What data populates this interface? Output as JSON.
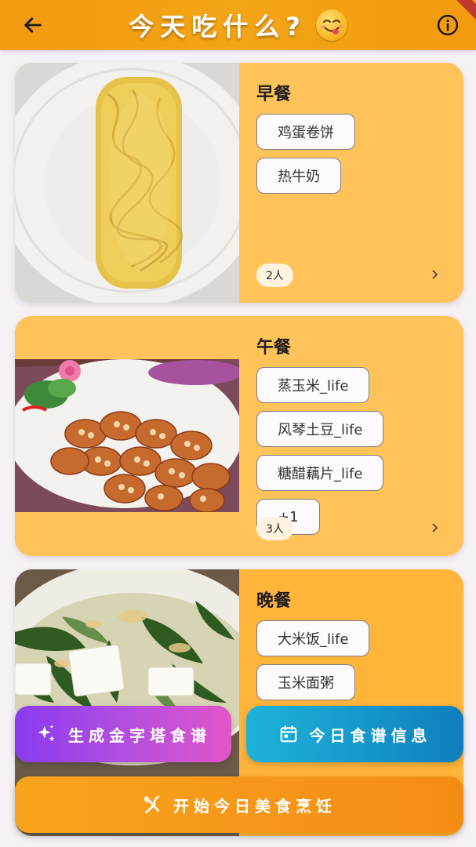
{
  "appbar": {
    "title": "今天吃什么?",
    "emoji_icon": "smiling-face-tongue-icon",
    "back_icon": "arrow-left-icon",
    "info_icon": "info-circle-icon",
    "accent_color": "#f39a0f"
  },
  "meals": [
    {
      "title": "早餐",
      "dishes": [
        "鸡蛋卷饼",
        "热牛奶"
      ],
      "people": "2人",
      "photo": "egg-roll-on-plate",
      "panel_color": "#ffc35a"
    },
    {
      "title": "午餐",
      "dishes": [
        "蒸玉米_life",
        "风琴土豆_life",
        "糖醋藕片_life",
        "+1"
      ],
      "people": "3人",
      "photo": "fried-lotus-root-slices",
      "panel_color": "#ffc35a"
    },
    {
      "title": "晚餐",
      "dishes": [
        "大米饭_life",
        "玉米面粥"
      ],
      "photo": "spinach-tofu-soup",
      "panel_color": "#ffb43a"
    }
  ],
  "actions": {
    "pyramid_label": "生成金字塔食谱",
    "pyramid_icon": "sparkle-icon",
    "info_label": "今日食谱信息",
    "info_icon": "calendar-icon",
    "cook_label": "开始今日美食烹饪",
    "cook_icon": "fork-knife-icon"
  }
}
